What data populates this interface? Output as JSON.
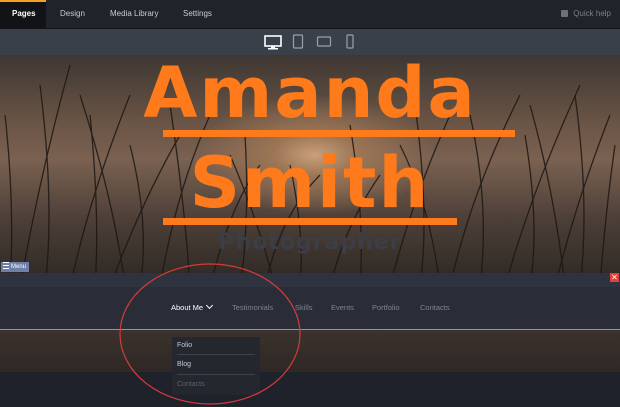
{
  "topbar": {
    "tabs": [
      {
        "label": "Pages"
      },
      {
        "label": "Design"
      },
      {
        "label": "Media Library"
      },
      {
        "label": "Settings"
      }
    ],
    "quick_help": "Quick help",
    "accent_color": "#f4a21f"
  },
  "device_toolbar": {
    "devices": [
      "desktop-icon",
      "tablet-portrait-icon",
      "tablet-landscape-icon",
      "mobile-icon"
    ],
    "selected": "desktop-icon"
  },
  "hero": {
    "name_line_1": "Amanda",
    "name_line_2": "Smith",
    "subtitle": "Photographer",
    "title_color": "#ff7a1a"
  },
  "menu_section": {
    "tag_label": "Menu",
    "items": [
      {
        "label": "About Me",
        "active": true
      },
      {
        "label": "Testimonials"
      },
      {
        "label": "Skills"
      },
      {
        "label": "Events"
      },
      {
        "label": "Portfolio"
      },
      {
        "label": "Contacts"
      }
    ],
    "dropdown": [
      "Folio",
      "Blog",
      "Contacts"
    ],
    "selection_border_color": "#3fb7c4"
  },
  "annotation": {
    "color": "#d63a3a"
  }
}
